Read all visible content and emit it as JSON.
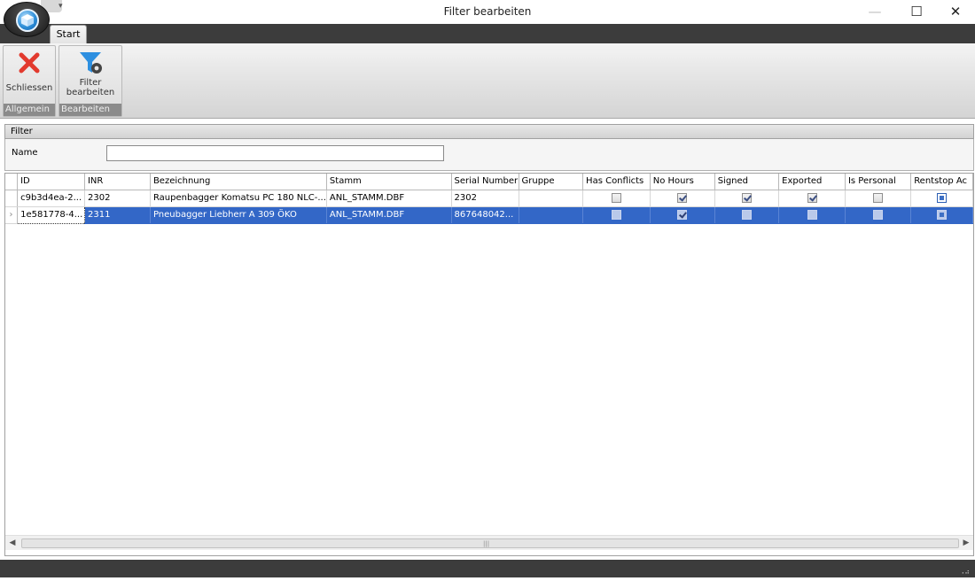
{
  "window": {
    "title": "Filter bearbeiten",
    "minimize": "—",
    "maximize": "☐",
    "close": "✕"
  },
  "app_menu": {
    "icon": "app-cube-icon"
  },
  "quick_access": {
    "arrow": "▾"
  },
  "tabs": [
    {
      "label": "Start"
    }
  ],
  "ribbon": {
    "groups": [
      {
        "label": "Allgemein",
        "buttons": [
          {
            "label": "Schliessen",
            "icon": "close-x-icon"
          }
        ]
      },
      {
        "label": "Bearbeiten",
        "buttons": [
          {
            "label_line1": "Filter",
            "label_line2": "bearbeiten",
            "icon": "filter-gear-icon"
          }
        ]
      }
    ]
  },
  "filter": {
    "header": "Filter",
    "name_label": "Name",
    "name_value": ""
  },
  "grid": {
    "columns": [
      "ID",
      "INR",
      "Bezeichnung",
      "Stamm",
      "Serial Number",
      "Gruppe",
      "Has Conflicts",
      "No Hours",
      "Signed",
      "Exported",
      "Is Personal",
      "Rentstop Ac"
    ],
    "rows": [
      {
        "id": "c9b3d4ea-2...",
        "inr": "2302",
        "bezeichnung": "Raupenbagger Komatsu PC 180 NLC-...",
        "stamm": "ANL_STAMM.DBF",
        "serial": "2302",
        "gruppe": "",
        "has_conflicts": false,
        "no_hours": true,
        "signed": true,
        "exported": true,
        "is_personal": false,
        "rentstop": "indeterminate",
        "selected": false
      },
      {
        "id": "1e581778-4...",
        "inr": "2311",
        "bezeichnung": "Pneubagger Liebherr A 309 ÖKO",
        "stamm": "ANL_STAMM.DBF",
        "serial": "867648042...",
        "gruppe": "",
        "has_conflicts": false,
        "no_hours": true,
        "signed": false,
        "exported": false,
        "is_personal": false,
        "rentstop": "indeterminate",
        "selected": true
      }
    ],
    "row_indicator": "›"
  },
  "scrollbar": {
    "left": "◀",
    "right": "▶",
    "grip": "|||"
  },
  "colors": {
    "selection": "#3367c7",
    "chrome_dark": "#3c3c3c",
    "close_x": "#e23a2e",
    "filter_blue": "#2d8fe0"
  }
}
